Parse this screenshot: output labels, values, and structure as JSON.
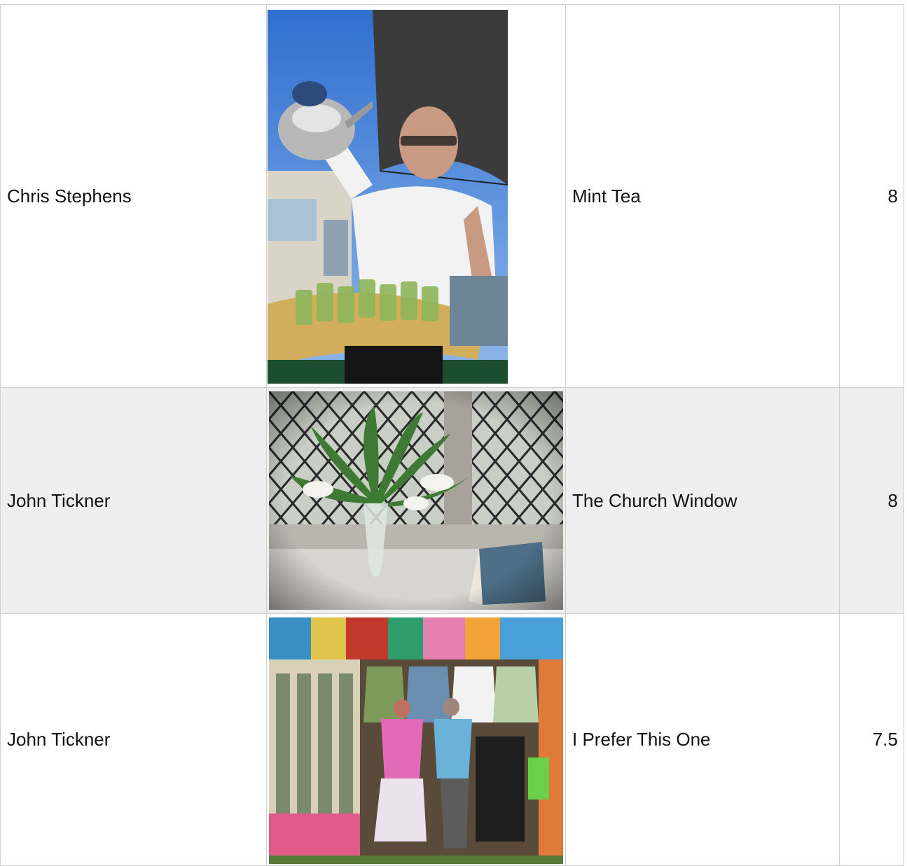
{
  "rows": [
    {
      "author": "Chris Stephens",
      "photo": "photo-mint-tea",
      "title": "Mint Tea",
      "score": "8"
    },
    {
      "author": "John Tickner",
      "photo": "photo-church-window",
      "title": "The Church Window",
      "score": "8"
    },
    {
      "author": "John Tickner",
      "photo": "photo-market-stall",
      "title": "I Prefer This One",
      "score": "7.5"
    }
  ],
  "colors": {
    "border": "#cfcfcf",
    "alt_row": "#efefef"
  }
}
